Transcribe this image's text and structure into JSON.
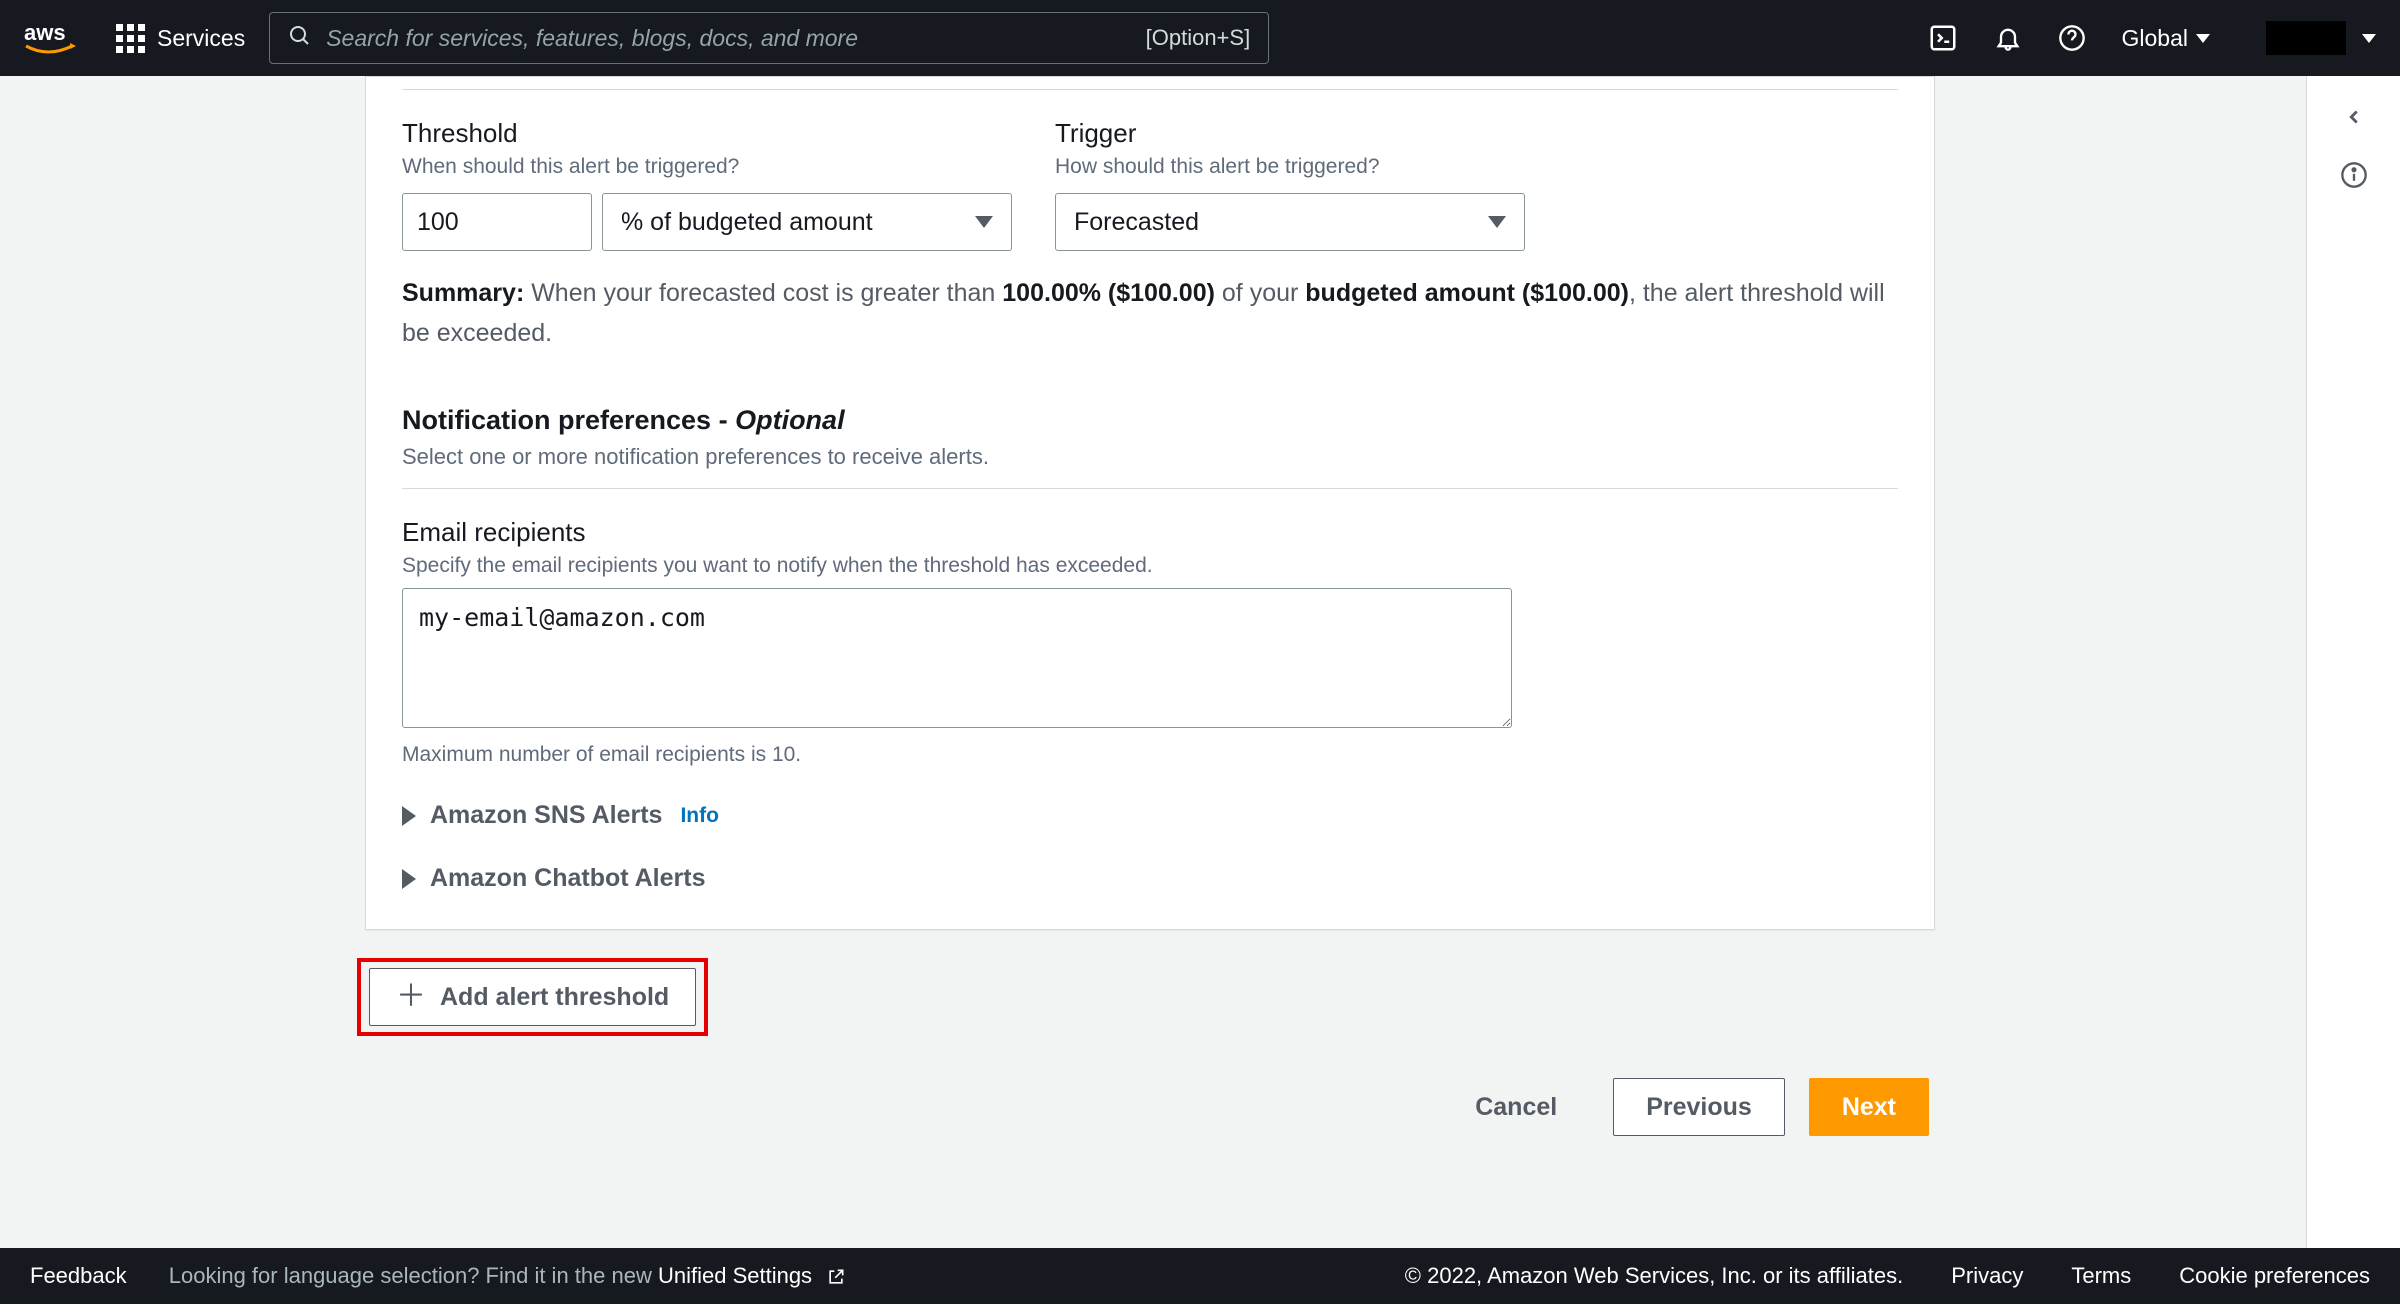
{
  "nav": {
    "services": "Services",
    "search_placeholder": "Search for services, features, blogs, docs, and more",
    "shortcut": "[Option+S]",
    "region": "Global"
  },
  "threshold": {
    "label": "Threshold",
    "help": "When should this alert be triggered?",
    "value": "100",
    "unit": "% of budgeted amount"
  },
  "trigger": {
    "label": "Trigger",
    "help": "How should this alert be triggered?",
    "value": "Forecasted"
  },
  "summary": {
    "prefix": "Summary:",
    "t1": " When your forecasted cost is greater than ",
    "b1": "100.00% ($100.00)",
    "t2": " of your ",
    "b2": "budgeted amount ($100.00)",
    "t3": ", the alert threshold will be exceeded."
  },
  "notif": {
    "title": "Notification preferences - ",
    "optional": "Optional",
    "sub": "Select one or more notification preferences to receive alerts."
  },
  "email": {
    "label": "Email recipients",
    "help": "Specify the email recipients you want to notify when the threshold has exceeded.",
    "value": "my-email@amazon.com",
    "max": "Maximum number of email recipients is 10."
  },
  "expanders": {
    "sns": "Amazon SNS Alerts",
    "sns_info": "Info",
    "chatbot": "Amazon Chatbot Alerts"
  },
  "add_btn": "Add alert threshold",
  "actions": {
    "cancel": "Cancel",
    "previous": "Previous",
    "next": "Next"
  },
  "footer": {
    "feedback": "Feedback",
    "lang1": "Looking for language selection? Find it in the new ",
    "lang2": "Unified Settings",
    "copy": "© 2022, Amazon Web Services, Inc. or its affiliates.",
    "privacy": "Privacy",
    "terms": "Terms",
    "cookies": "Cookie preferences"
  }
}
